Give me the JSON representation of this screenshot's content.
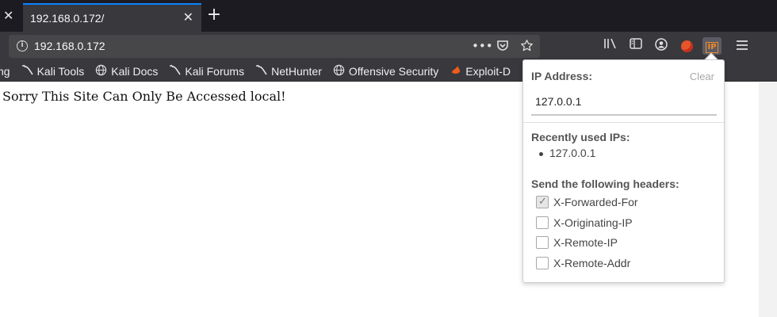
{
  "tab": {
    "title": "192.168.0.172/",
    "close_glyph": "✕",
    "new_tab_glyph": "+"
  },
  "urlbar": {
    "url": "192.168.0.172",
    "info_icon": "i",
    "actions": [
      "•••",
      "pocket-icon",
      "star-icon"
    ]
  },
  "bookmarks": [
    {
      "label": "ng",
      "icon": "none"
    },
    {
      "label": "Kali Tools",
      "icon": "kali-dragon-icon"
    },
    {
      "label": "Kali Docs",
      "icon": "globe-icon"
    },
    {
      "label": "Kali Forums",
      "icon": "kali-dragon-icon"
    },
    {
      "label": "NetHunter",
      "icon": "kali-dragon-icon"
    },
    {
      "label": "Offensive Security",
      "icon": "globe-icon"
    },
    {
      "label": "Exploit-D",
      "icon": "exploit-db-icon"
    }
  ],
  "page": {
    "message": "Sorry This Site Can Only Be Accessed local!"
  },
  "popup": {
    "ip_label": "IP Address:",
    "clear_label": "Clear",
    "ip_value": "127.0.0.1",
    "recent_label": "Recently used IPs:",
    "recent_ips": [
      "127.0.0.1"
    ],
    "headers_label": "Send the following headers:",
    "headers": [
      {
        "name": "X-Forwarded-For",
        "checked": true
      },
      {
        "name": "X-Originating-IP",
        "checked": false
      },
      {
        "name": "X-Remote-IP",
        "checked": false
      },
      {
        "name": "X-Remote-Addr",
        "checked": false
      }
    ]
  },
  "colors": {
    "tab_accent": "#0a84ff",
    "chrome_dark": "#38383d",
    "ip_extension": "#f08a24"
  }
}
